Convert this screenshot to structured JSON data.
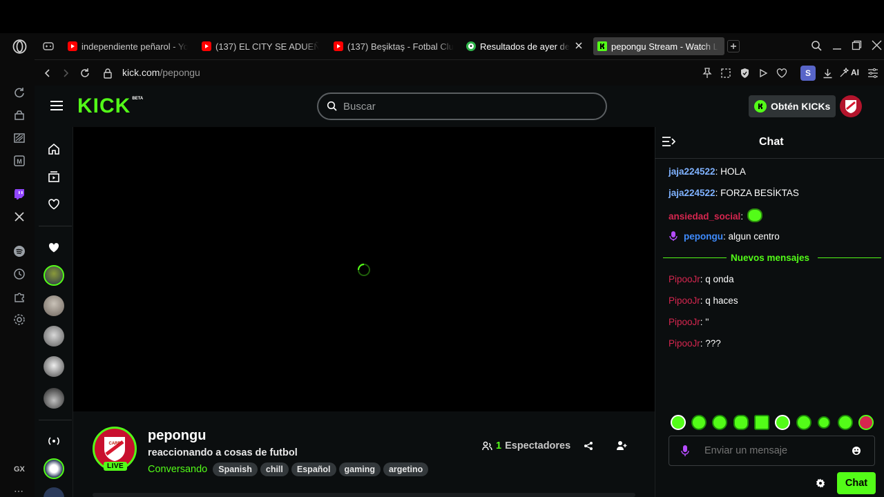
{
  "tabs": [
    {
      "title": "independiente peñarol - Yo",
      "favicon": "youtube-icon"
    },
    {
      "title": "(137) EL CITY SE ADUEÑÓ",
      "favicon": "youtube-icon"
    },
    {
      "title": "(137) Beşiktaş - Fotbal Clu",
      "favicon": "youtube-icon"
    },
    {
      "title": "Resultados de ayer de",
      "favicon": "soccer-ball-icon"
    },
    {
      "title": "pepongu Stream - Watch L",
      "favicon": "kick-icon"
    }
  ],
  "address": {
    "host": "kick.com",
    "path": "/pepongu"
  },
  "toolbar": {
    "profile_letter": "S",
    "ai_label": "AI"
  },
  "kick": {
    "logo": "KICK",
    "logo_badge": "BETA",
    "search_placeholder": "Buscar",
    "kicks_button": "Obtén KICKs"
  },
  "stream": {
    "channel": "pepongu",
    "title": "reaccionando a cosas de futbol",
    "category": "Conversando",
    "live_badge": "LIVE",
    "viewers_count": "1",
    "viewers_label": "Espectadores",
    "tags": [
      "Spanish",
      "chill",
      "Español",
      "gaming",
      "argetino"
    ]
  },
  "chat": {
    "header": "Chat",
    "messages": [
      {
        "user": "jaja224522",
        "text": ": HOLA",
        "color": "#7fb2ff"
      },
      {
        "user": "jaja224522",
        "text": ": FORZA BESİKTAS",
        "color": "#7fb2ff"
      },
      {
        "user": "ansiedad_social",
        "text": ":",
        "color": "#d6264f"
      },
      {
        "user": "pepongu",
        "text": ": algun centro",
        "color": "#3f8cff"
      }
    ],
    "new_messages_label": "Nuevos mensajes",
    "new_messages": [
      {
        "user": "PipooJr",
        "text": ": q onda",
        "color": "#d6264f"
      },
      {
        "user": "PipooJr",
        "text": ": q haces",
        "color": "#d6264f"
      },
      {
        "user": "PipooJr",
        "text": ": ''",
        "color": "#d6264f"
      },
      {
        "user": "PipooJr",
        "text": ": ???",
        "color": "#d6264f"
      }
    ],
    "input_placeholder": "Enviar un mensaje",
    "send_button": "Chat"
  },
  "opera": {
    "gx_label": "GX"
  },
  "colors": {
    "kick_green": "#53fc18",
    "bg": "#0b0e0f"
  }
}
